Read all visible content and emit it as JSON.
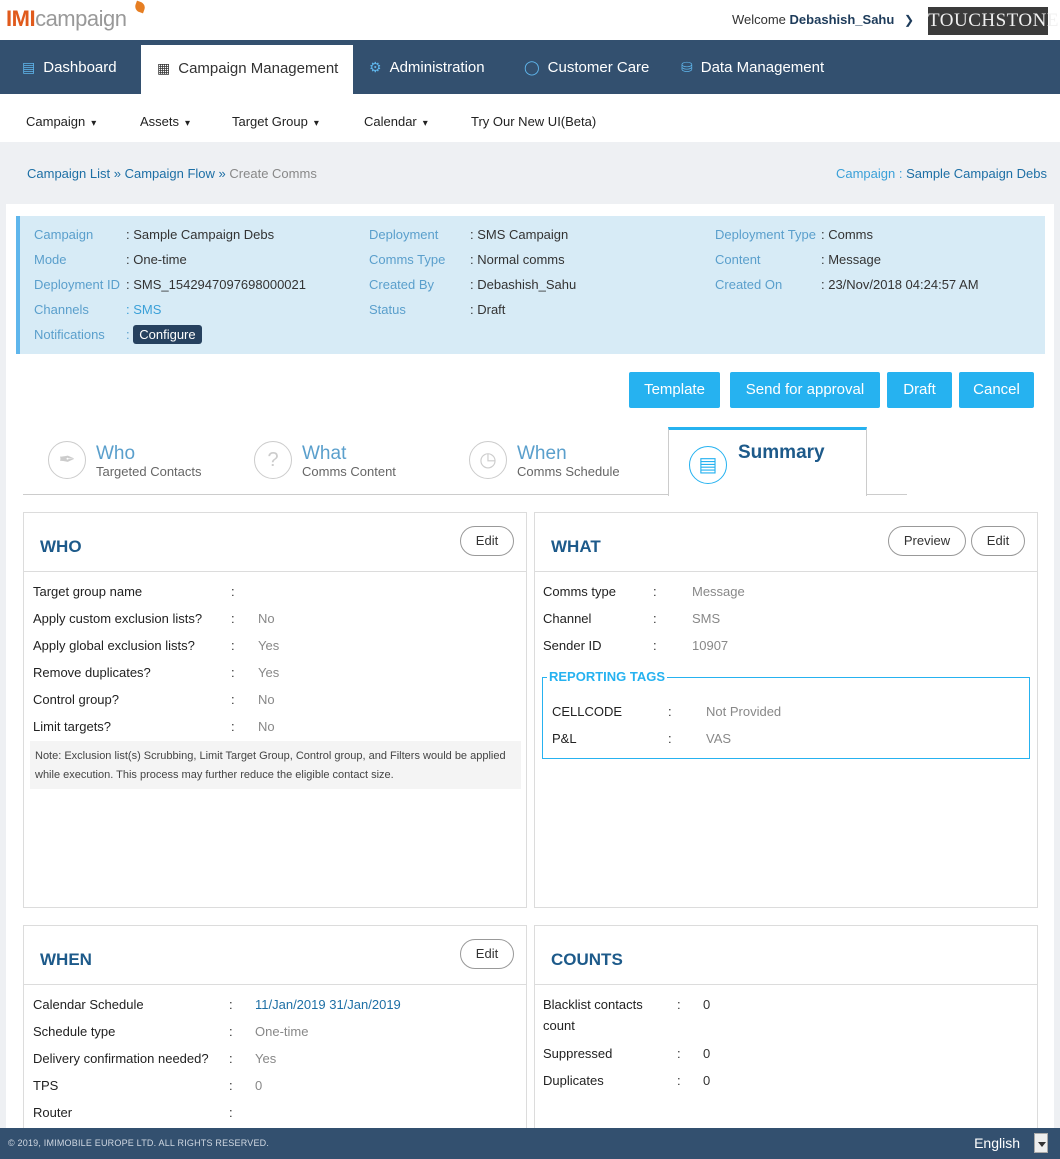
{
  "header": {
    "logo_imi": "IMI",
    "logo_campaign": "campaign",
    "welcome_prefix": "Welcome",
    "username": "Debashish_Sahu",
    "brand": "TOUCHSTONE"
  },
  "mainnav": [
    {
      "label": "Dashboard",
      "icon": "bar-chart-icon"
    },
    {
      "label": "Campaign Management",
      "icon": "document-icon"
    },
    {
      "label": "Administration",
      "icon": "gears-icon"
    },
    {
      "label": "Customer Care",
      "icon": "headset-icon"
    },
    {
      "label": "Data Management",
      "icon": "database-icon"
    }
  ],
  "subnav": [
    {
      "label": "Campaign"
    },
    {
      "label": "Assets"
    },
    {
      "label": "Target Group"
    },
    {
      "label": "Calendar"
    },
    {
      "label": "Try Our New UI(Beta)"
    }
  ],
  "breadcrumb": {
    "campaign_list": "Campaign List",
    "sep": "»",
    "campaign_flow": "Campaign Flow",
    "current": "Create Comms",
    "right_label": "Campaign :",
    "right_value": "Sample Campaign Debs"
  },
  "info": {
    "campaign_label": "Campaign",
    "campaign_value": ": Sample Campaign Debs",
    "mode_label": "Mode",
    "mode_value": ": One-time",
    "depid_label": "Deployment ID",
    "depid_value": ": SMS_1542947097698000021",
    "channels_label": "Channels",
    "channels_value": ": SMS",
    "notif_label": "Notifications",
    "notif_colon": ":",
    "configure": "Configure",
    "deployment_label": "Deployment",
    "deployment_value": ": SMS Campaign",
    "commstype_label": "Comms Type",
    "commstype_value": ": Normal comms",
    "createdby_label": "Created By",
    "createdby_value": ": Debashish_Sahu",
    "status_label": "Status",
    "status_value": ": Draft",
    "deptype_label": "Deployment Type",
    "deptype_value": ": Comms",
    "content_label": "Content",
    "content_value": ": Message",
    "createdon_label": "Created On",
    "createdon_value": ": 23/Nov/2018 04:24:57 AM"
  },
  "actions": {
    "template": "Template",
    "send": "Send for approval",
    "draft": "Draft",
    "cancel": "Cancel"
  },
  "tabs": [
    {
      "title": "Who",
      "sub": "Targeted Contacts"
    },
    {
      "title": "What",
      "sub": "Comms Content"
    },
    {
      "title": "When",
      "sub": "Comms Schedule"
    },
    {
      "title": "Summary",
      "sub": ""
    }
  ],
  "who": {
    "title": "WHO",
    "edit": "Edit",
    "rows": [
      {
        "k": "Target group name",
        "c": ":",
        "v": ""
      },
      {
        "k": "Apply custom exclusion lists?",
        "c": ":",
        "v": "No"
      },
      {
        "k": "Apply global exclusion lists?",
        "c": ":",
        "v": "Yes"
      },
      {
        "k": "Remove duplicates?",
        "c": ":",
        "v": "Yes"
      },
      {
        "k": "Control group?",
        "c": ":",
        "v": "No"
      },
      {
        "k": "Limit targets?",
        "c": ":",
        "v": "No"
      }
    ],
    "note": "Note: Exclusion list(s) Scrubbing, Limit Target Group, Control group, and Filters would be applied while execution. This process may further reduce the eligible contact size."
  },
  "what": {
    "title": "WHAT",
    "preview": "Preview",
    "edit": "Edit",
    "rows": [
      {
        "k": "Comms type",
        "c": ":",
        "v": "Message"
      },
      {
        "k": "Channel",
        "c": ":",
        "v": "SMS"
      },
      {
        "k": "Sender ID",
        "c": ":",
        "v": "10907"
      }
    ],
    "tags_legend": "REPORTING TAGS",
    "tags": [
      {
        "k": "CELLCODE",
        "c": ":",
        "v": "Not Provided"
      },
      {
        "k": "P&L",
        "c": ":",
        "v": "VAS"
      }
    ]
  },
  "when": {
    "title": "WHEN",
    "edit": "Edit",
    "rows": [
      {
        "k": "Calendar Schedule",
        "c": ":",
        "v": "11/Jan/2019 31/Jan/2019"
      },
      {
        "k": "Schedule type",
        "c": ":",
        "v": "One-time"
      },
      {
        "k": "Delivery confirmation needed?",
        "c": ":",
        "v": "Yes"
      },
      {
        "k": "TPS",
        "c": ":",
        "v": "0"
      },
      {
        "k": "Router",
        "c": ":",
        "v": ""
      }
    ]
  },
  "counts": {
    "title": "COUNTS",
    "rows": [
      {
        "k": "Blacklist contacts",
        "k2": "count",
        "c": ":",
        "v": "0"
      },
      {
        "k": "Suppressed",
        "c": ":",
        "v": "0"
      },
      {
        "k": "Duplicates",
        "c": ":",
        "v": "0"
      }
    ]
  },
  "footer": {
    "copyright": "© 2019, IMIMOBILE EUROPE LTD. ALL RIGHTS RESERVED.",
    "language": "English"
  }
}
